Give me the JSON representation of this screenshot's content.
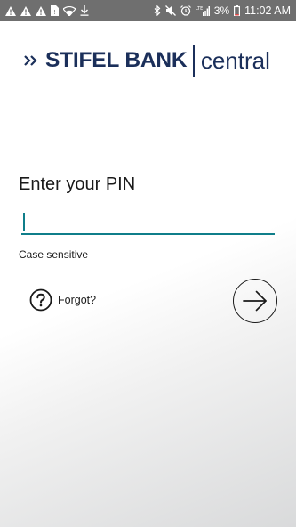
{
  "status_bar": {
    "battery_percent": "3%",
    "time": "11:02 AM",
    "network": "LTE",
    "left_icons": [
      "warning-icon",
      "warning-icon",
      "warning-icon",
      "sim-icon",
      "wifi-icon",
      "download-icon"
    ],
    "right_icons": [
      "bluetooth-icon",
      "mute-icon",
      "alarm-icon",
      "signal-icon",
      "battery-icon"
    ]
  },
  "brand": {
    "name": "STIFEL BANK",
    "product": "central",
    "color": "#1b2f5a"
  },
  "login": {
    "title": "Enter your PIN",
    "pin_value": "",
    "hint": "Case sensitive",
    "forgot_label": "Forgot?",
    "submit_icon": "arrow-right-icon",
    "accent_color": "#0f7e8a"
  }
}
